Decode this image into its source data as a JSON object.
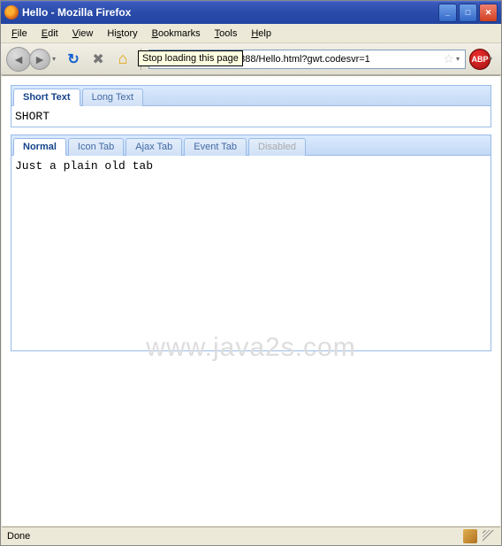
{
  "window": {
    "title": "Hello - Mozilla Firefox",
    "minimize": "_",
    "maximize": "□",
    "close": "✕"
  },
  "menu": {
    "file": "File",
    "edit": "Edit",
    "view": "View",
    "history": "History",
    "bookmarks": "Bookmarks",
    "tools": "Tools",
    "help": "Help"
  },
  "toolbar": {
    "back": "◄",
    "forward": "►",
    "reload_glyph": "↻",
    "stop_glyph": "✖",
    "home_glyph": "⌂",
    "url": "http://localhost:8888/Hello.html?gwt.codesvr=1",
    "star": "☆",
    "dropdown": "▾",
    "abp": "ABP",
    "tooltip": "Stop loading this page"
  },
  "panel1": {
    "tabs": [
      {
        "label": "Short Text",
        "active": true
      },
      {
        "label": "Long Text",
        "active": false
      }
    ],
    "content": "SHORT"
  },
  "panel2": {
    "tabs": [
      {
        "label": "Normal",
        "active": true,
        "disabled": false
      },
      {
        "label": "Icon Tab",
        "active": false,
        "disabled": false
      },
      {
        "label": "Ajax Tab",
        "active": false,
        "disabled": false
      },
      {
        "label": "Event Tab",
        "active": false,
        "disabled": false
      },
      {
        "label": "Disabled",
        "active": false,
        "disabled": true
      }
    ],
    "content": "Just a plain old tab"
  },
  "watermark": "www.java2s.com",
  "status": {
    "text": "Done"
  }
}
